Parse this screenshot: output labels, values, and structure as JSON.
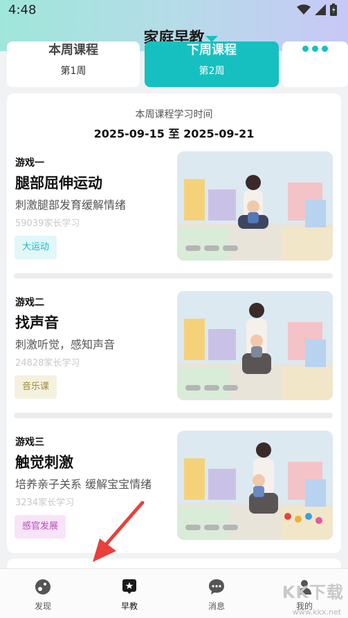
{
  "status_bar": {
    "time": "4:48"
  },
  "header": {
    "title": "家庭早教"
  },
  "week_tabs": [
    {
      "title": "本周课程",
      "sub": "第1周"
    },
    {
      "title": "下周课程",
      "sub": "第2周"
    }
  ],
  "study": {
    "caption": "本周课程学习时间",
    "range": "2025-09-15 至 2025-09-21"
  },
  "games": [
    {
      "no": "游戏一",
      "name": "腿部屈伸运动",
      "desc": "刺激腿部发育缓解情绪",
      "count": "59039家长学习",
      "tag": "大运动",
      "tag_color": "#1cb8c4",
      "tag_bg": "#e3f6f8"
    },
    {
      "no": "游戏二",
      "name": "找声音",
      "desc": "刺激听觉，感知声音",
      "count": "24828家长学习",
      "tag": "音乐课",
      "tag_color": "#9e8a3a",
      "tag_bg": "#f4f1df"
    },
    {
      "no": "游戏三",
      "name": "触觉刺激",
      "desc": "培养亲子关系 缓解宝宝情绪",
      "count": "3234家长学习",
      "tag": "感官发展",
      "tag_color": "#b34fb9",
      "tag_bg": "#f9e3f8"
    }
  ],
  "nav": [
    {
      "label": "发现",
      "icon": "discover-icon"
    },
    {
      "label": "早教",
      "icon": "early-education-icon"
    },
    {
      "label": "消息",
      "icon": "message-icon"
    },
    {
      "label": "我的",
      "icon": "profile-icon"
    }
  ],
  "watermark": {
    "text": "KK下载",
    "url": "www.kkx.net"
  },
  "colors": {
    "accent": "#17c0c0"
  }
}
